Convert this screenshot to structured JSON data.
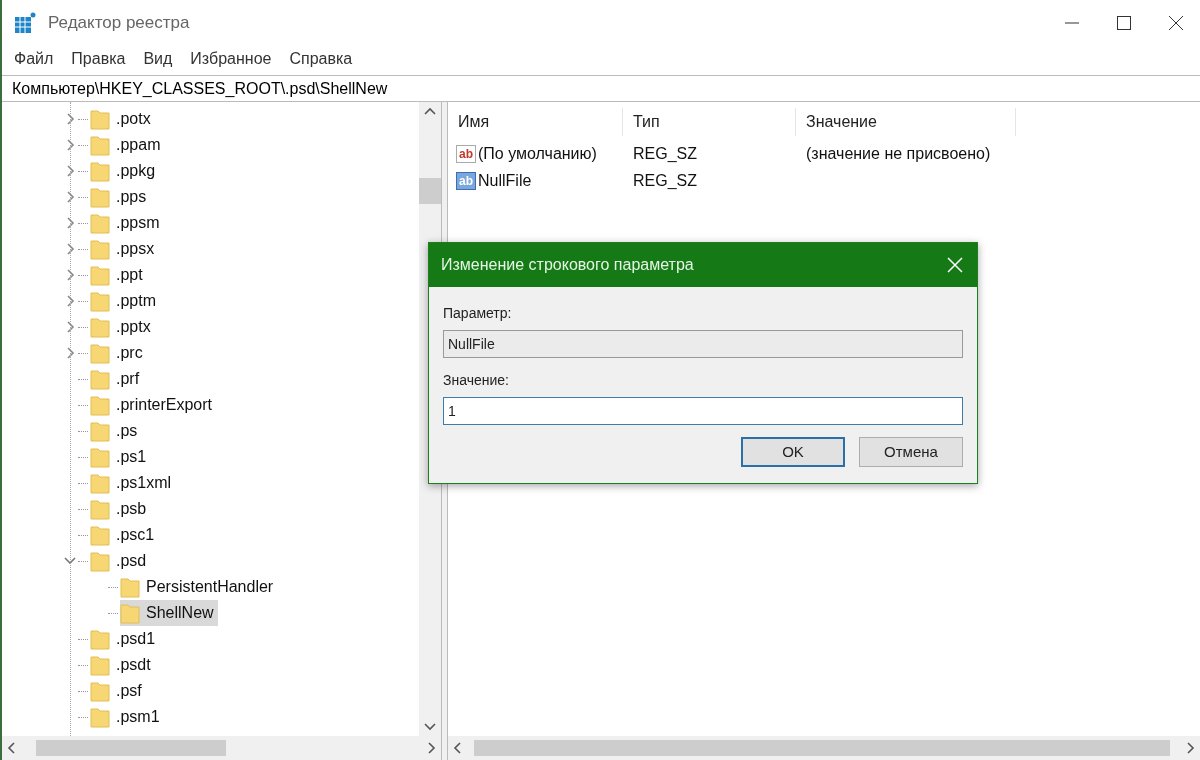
{
  "window": {
    "title": "Редактор реестра"
  },
  "menu": [
    "Файл",
    "Правка",
    "Вид",
    "Избранное",
    "Справка"
  ],
  "address": "Компьютер\\HKEY_CLASSES_ROOT\\.psd\\ShellNew",
  "tree": [
    {
      "label": ".potx",
      "expanded": false,
      "selected": false
    },
    {
      "label": ".ppam",
      "expanded": false,
      "selected": false
    },
    {
      "label": ".ppkg",
      "expanded": false,
      "selected": false
    },
    {
      "label": ".pps",
      "expanded": false,
      "selected": false
    },
    {
      "label": ".ppsm",
      "expanded": false,
      "selected": false
    },
    {
      "label": ".ppsx",
      "expanded": false,
      "selected": false
    },
    {
      "label": ".ppt",
      "expanded": false,
      "selected": false
    },
    {
      "label": ".pptm",
      "expanded": false,
      "selected": false
    },
    {
      "label": ".pptx",
      "expanded": false,
      "selected": false
    },
    {
      "label": ".prc",
      "expanded": false,
      "selected": false
    },
    {
      "label": ".prf",
      "selected": false
    },
    {
      "label": ".printerExport",
      "selected": false
    },
    {
      "label": ".ps",
      "selected": false
    },
    {
      "label": ".ps1",
      "selected": false
    },
    {
      "label": ".ps1xml",
      "selected": false
    },
    {
      "label": ".psb",
      "selected": false
    },
    {
      "label": ".psc1",
      "selected": false
    },
    {
      "label": ".psd",
      "expanded": true,
      "selected": false,
      "children": [
        {
          "label": "PersistentHandler",
          "selected": false
        },
        {
          "label": "ShellNew",
          "selected": true
        }
      ]
    },
    {
      "label": ".psd1",
      "selected": false
    },
    {
      "label": ".psdt",
      "selected": false
    },
    {
      "label": ".psf",
      "selected": false
    },
    {
      "label": ".psm1",
      "selected": false
    }
  ],
  "values": {
    "columns": [
      "Имя",
      "Тип",
      "Значение"
    ],
    "rows": [
      {
        "icon_text": "ab",
        "name": "(По умолчанию)",
        "type": "REG_SZ",
        "data": "(значение не присвоено)",
        "selected": false
      },
      {
        "icon_text": "ab",
        "name": "NullFile",
        "type": "REG_SZ",
        "selected": true
      }
    ]
  },
  "dialog": {
    "title": "Изменение строкового параметра",
    "name_label": "Параметр:",
    "name_value": "NullFile",
    "value_label": "Значение:",
    "value_value": "1",
    "buttons": [
      {
        "label": "OK",
        "default": true
      },
      {
        "label": "Отмена",
        "default": false
      }
    ]
  }
}
